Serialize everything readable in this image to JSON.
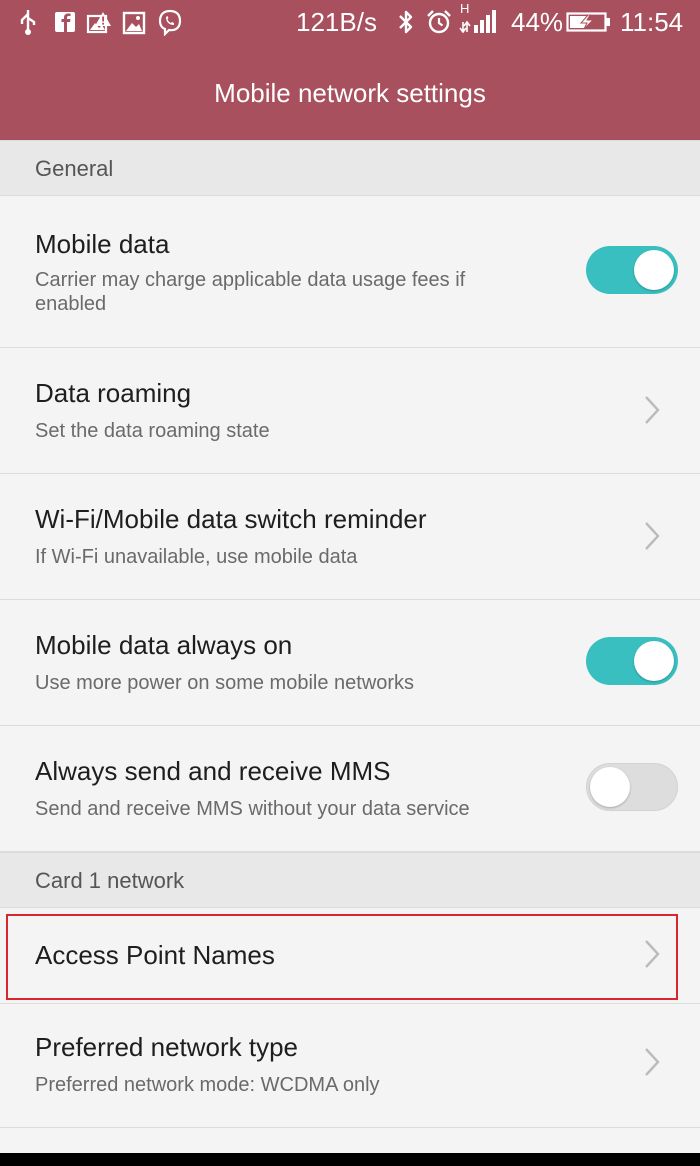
{
  "status_bar": {
    "speed": "121B/s",
    "battery": "44%",
    "time": "11:54",
    "network_label": "H",
    "icons": [
      "usb-icon",
      "facebook-icon",
      "warning-image-icon",
      "gallery-icon",
      "viber-icon",
      "bluetooth-icon",
      "alarm-icon",
      "signal-icon",
      "battery-charging-icon"
    ]
  },
  "header": {
    "title": "Mobile network settings",
    "color": "#a8505d"
  },
  "sections": {
    "general": {
      "label": "General"
    },
    "card1": {
      "label": "Card 1 network"
    }
  },
  "rows": {
    "mobile_data": {
      "title": "Mobile data",
      "subtitle": "Carrier may charge applicable data usage fees if enabled",
      "toggle": "on"
    },
    "data_roaming": {
      "title": "Data roaming",
      "subtitle": "Set the data roaming state"
    },
    "wifi_switch": {
      "title": "Wi-Fi/Mobile data switch reminder",
      "subtitle": "If Wi-Fi unavailable, use mobile data"
    },
    "always_on": {
      "title": "Mobile data always on",
      "subtitle": "Use more power on some mobile networks",
      "toggle": "on"
    },
    "mms": {
      "title": "Always send and receive MMS",
      "subtitle": "Send and receive MMS without your data service",
      "toggle": "off"
    },
    "apn": {
      "title": "Access Point Names"
    },
    "preferred": {
      "title": "Preferred network type",
      "subtitle": "Preferred network mode: WCDMA only"
    }
  },
  "colors": {
    "toggle_on": "#3abfc1",
    "highlight": "#d8262f"
  }
}
